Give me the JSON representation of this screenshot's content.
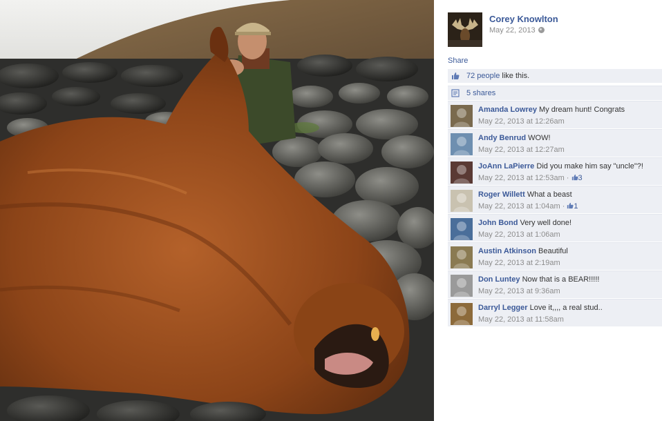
{
  "post": {
    "author": "Corey Knowlton",
    "date": "May 22, 2013",
    "share_label": "Share"
  },
  "stats": {
    "likes_link": "72 people",
    "likes_suffix": " like this.",
    "shares": "5 shares"
  },
  "comments": [
    {
      "author": "Amanda Lowrey",
      "text": "My dream hunt! Congrats",
      "time": "May 22, 2013 at 12:26am",
      "likes": "",
      "avatar_color": "#7a6a4e"
    },
    {
      "author": "Andy Benrud",
      "text": "WOW!",
      "time": "May 22, 2013 at 12:27am",
      "likes": "",
      "avatar_color": "#6e8fb0"
    },
    {
      "author": "JoAnn LaPierre",
      "text": "Did you make him say \"uncle\"?!",
      "time": "May 22, 2013 at 12:53am",
      "likes": "3",
      "avatar_color": "#5a3a34"
    },
    {
      "author": "Roger Willett",
      "text": "What a beast",
      "time": "May 22, 2013 at 1:04am",
      "likes": "1",
      "avatar_color": "#c9c2b0"
    },
    {
      "author": "John Bond",
      "text": "Very well done!",
      "time": "May 22, 2013 at 1:06am",
      "likes": "",
      "avatar_color": "#4a6e9a"
    },
    {
      "author": "Austin Atkinson",
      "text": "Beautiful",
      "time": "May 22, 2013 at 2:19am",
      "likes": "",
      "avatar_color": "#8a7a52"
    },
    {
      "author": "Don Luntey",
      "text": "Now that is a BEAR!!!!!",
      "time": "May 22, 2013 at 9:36am",
      "likes": "",
      "avatar_color": "#9a9a9a"
    },
    {
      "author": "Darryl Legger",
      "text": "Love it,,,, a real stud..",
      "time": "May 22, 2013 at 11:58am",
      "likes": "",
      "avatar_color": "#8c6a3a"
    }
  ],
  "colors": {
    "link": "#3b5998",
    "panel_bg": "#edeff4",
    "muted": "#8c8c8c"
  }
}
